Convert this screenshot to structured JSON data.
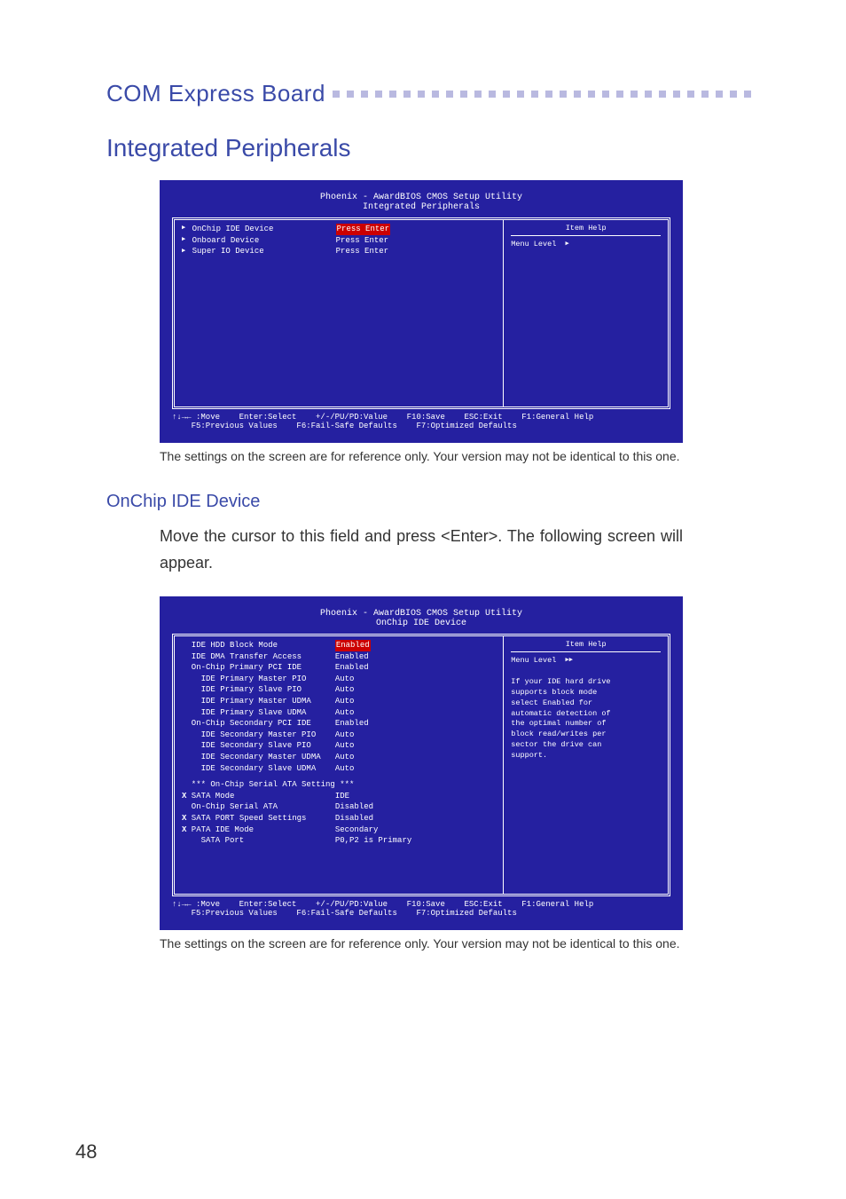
{
  "header_title": "COM Express Board",
  "section_title": "Integrated Peripherals",
  "bios1": {
    "title": "Phoenix - AwardBIOS CMOS Setup Utility\nIntegrated Peripherals",
    "rows": [
      {
        "arrow": true,
        "label": "OnChip IDE Device",
        "value": "Press Enter",
        "highlight": true
      },
      {
        "arrow": true,
        "label": "Onboard Device",
        "value": "Press Enter"
      },
      {
        "arrow": true,
        "label": "Super IO Device",
        "value": "Press Enter"
      }
    ],
    "help_title": "Item Help",
    "help_lines": [
      "Menu Level"
    ],
    "footer": "↑↓→← :Move    Enter:Select    +/-/PU/PD:Value    F10:Save    ESC:Exit    F1:General Help\n    F5:Previous Values    F6:Fail-Safe Defaults    F7:Optimized Defaults"
  },
  "caption1": "The settings on the screen are for reference only. Your version may not be identical to this one.",
  "subsection_title": "OnChip IDE Device",
  "body_text": "Move the cursor to this field and press <Enter>. The following screen will appear.",
  "bios2": {
    "title": "Phoenix - AwardBIOS CMOS Setup Utility\nOnChip IDE Device",
    "rows": [
      {
        "label": "IDE HDD Block Mode",
        "value": "Enabled",
        "highlight": true
      },
      {
        "label": "IDE DMA Transfer Access",
        "value": "Enabled"
      },
      {
        "label": "On-Chip Primary PCI IDE",
        "value": "Enabled"
      },
      {
        "label": "  IDE Primary Master PIO",
        "value": "Auto"
      },
      {
        "label": "  IDE Primary Slave PIO",
        "value": "Auto"
      },
      {
        "label": "  IDE Primary Master UDMA",
        "value": "Auto"
      },
      {
        "label": "  IDE Primary Slave UDMA",
        "value": "Auto"
      },
      {
        "label": "On-Chip Secondary PCI IDE",
        "value": "Enabled"
      },
      {
        "label": "  IDE Secondary Master PIO",
        "value": "Auto"
      },
      {
        "label": "  IDE Secondary Slave PIO",
        "value": "Auto"
      },
      {
        "label": "  IDE Secondary Master UDMA",
        "value": "Auto"
      },
      {
        "label": "  IDE Secondary Slave UDMA",
        "value": "Auto"
      },
      {
        "sep": true
      },
      {
        "label": "*** On-Chip Serial ATA Setting ***",
        "value": ""
      },
      {
        "x": true,
        "label": "SATA Mode",
        "value": "IDE"
      },
      {
        "label": "On-Chip Serial ATA",
        "value": "Disabled"
      },
      {
        "x": true,
        "label": "SATA PORT Speed Settings",
        "value": "Disabled"
      },
      {
        "x": true,
        "label": "PATA IDE Mode",
        "value": "Secondary"
      },
      {
        "label": "  SATA Port",
        "value": "P0,P2 is Primary"
      }
    ],
    "help_title": "Item Help",
    "help_lines": [
      "Menu Level",
      "",
      "If your IDE hard drive",
      "supports block mode",
      "select Enabled for",
      "automatic detection of",
      "the optimal number of",
      "block read/writes per",
      "sector the drive can",
      "support."
    ],
    "footer": "↑↓→← :Move    Enter:Select    +/-/PU/PD:Value    F10:Save    ESC:Exit    F1:General Help\n    F5:Previous Values    F6:Fail-Safe Defaults    F7:Optimized Defaults"
  },
  "caption2": "The settings on the screen are for reference only. Your version may not be identical to this one.",
  "page_number": "48"
}
